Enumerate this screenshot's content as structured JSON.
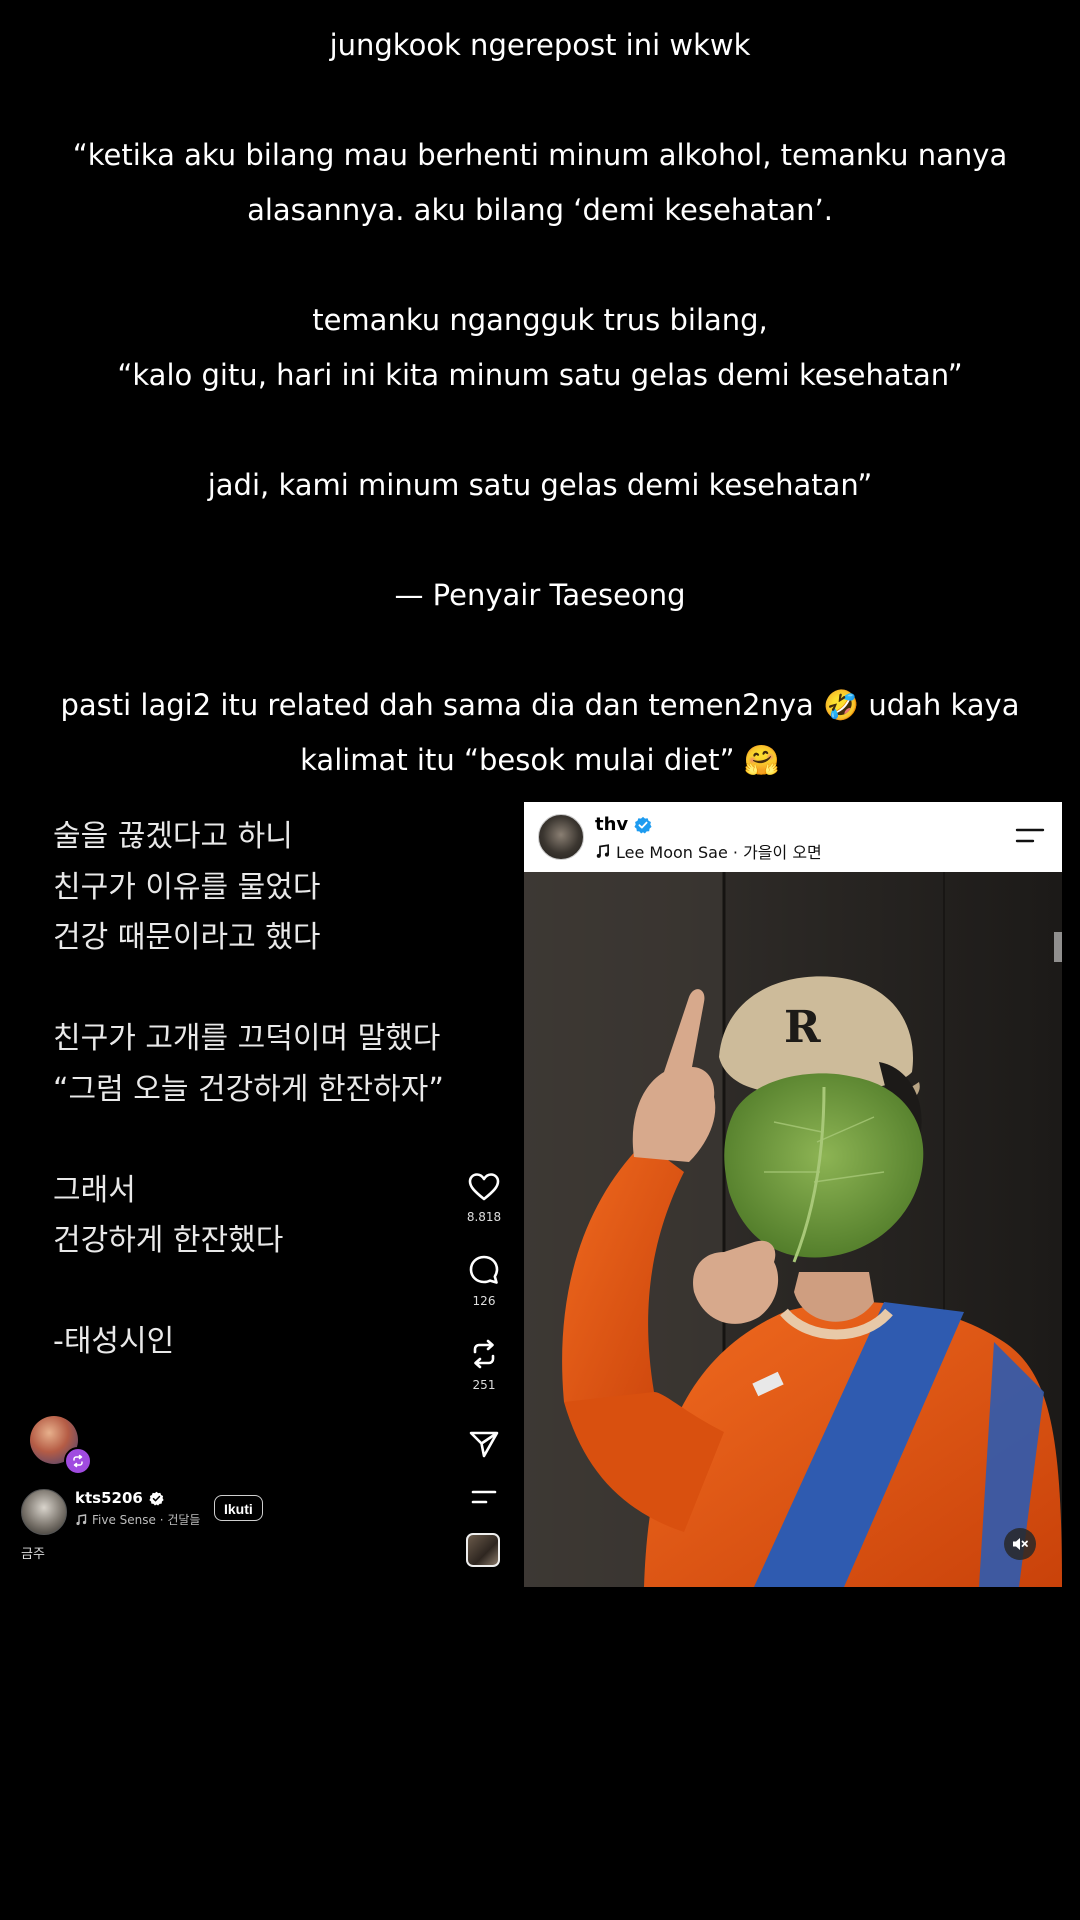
{
  "caption": {
    "lines": [
      "jungkook ngerepost ini wkwk",
      "",
      "“ketika aku bilang mau berhenti minum alkohol, temanku nanya",
      "alasannya. aku bilang ‘demi kesehatan’.",
      "",
      "temanku ngangguk trus bilang,",
      "“kalo gitu, hari ini kita minum satu gelas demi kesehatan”",
      "",
      "jadi, kami minum satu gelas demi kesehatan”",
      "",
      "— Penyair Taeseong",
      "",
      "pasti lagi2 itu related dah sama dia dan temen2nya 🤣 udah kaya",
      "kalimat itu “besok mulai diet” 🤗"
    ]
  },
  "left_post": {
    "poem": "술을 끊겠다고 하니\n친구가 이유를 물었다\n건강 때문이라고 했다\n\n친구가 고개를 끄덕이며 말했다\n“그럼 오늘 건강하게 한잔하자”\n\n그래서\n건강하게 한잔했다\n\n-태성시인",
    "like_count": "8.818",
    "comment_count": "126",
    "repost_count": "251",
    "author": {
      "username": "kts5206",
      "music": "Five Sense · 건달들"
    },
    "follow_label": "Ikuti",
    "post_caption": "금주"
  },
  "right_post": {
    "username": "thv",
    "music": "Lee Moon Sae · 가을이 오면",
    "photo_cap_letter": "R"
  },
  "colors": {
    "verified_blue": "#1d9bf0",
    "repost_purple": "#a04be0",
    "sweater_orange": "#e8520f",
    "strap_blue": "#2f5bb0",
    "cap_beige": "#cdbb9a",
    "leaf_green": "#6f9a3c"
  },
  "icons": {
    "like": "heart-icon",
    "comment": "comment-icon",
    "repost": "repost-icon",
    "share": "send-icon",
    "more": "menu-icon",
    "mute": "muted-speaker-icon",
    "music": "music-note-icon",
    "verified": "verified-badge-icon"
  }
}
